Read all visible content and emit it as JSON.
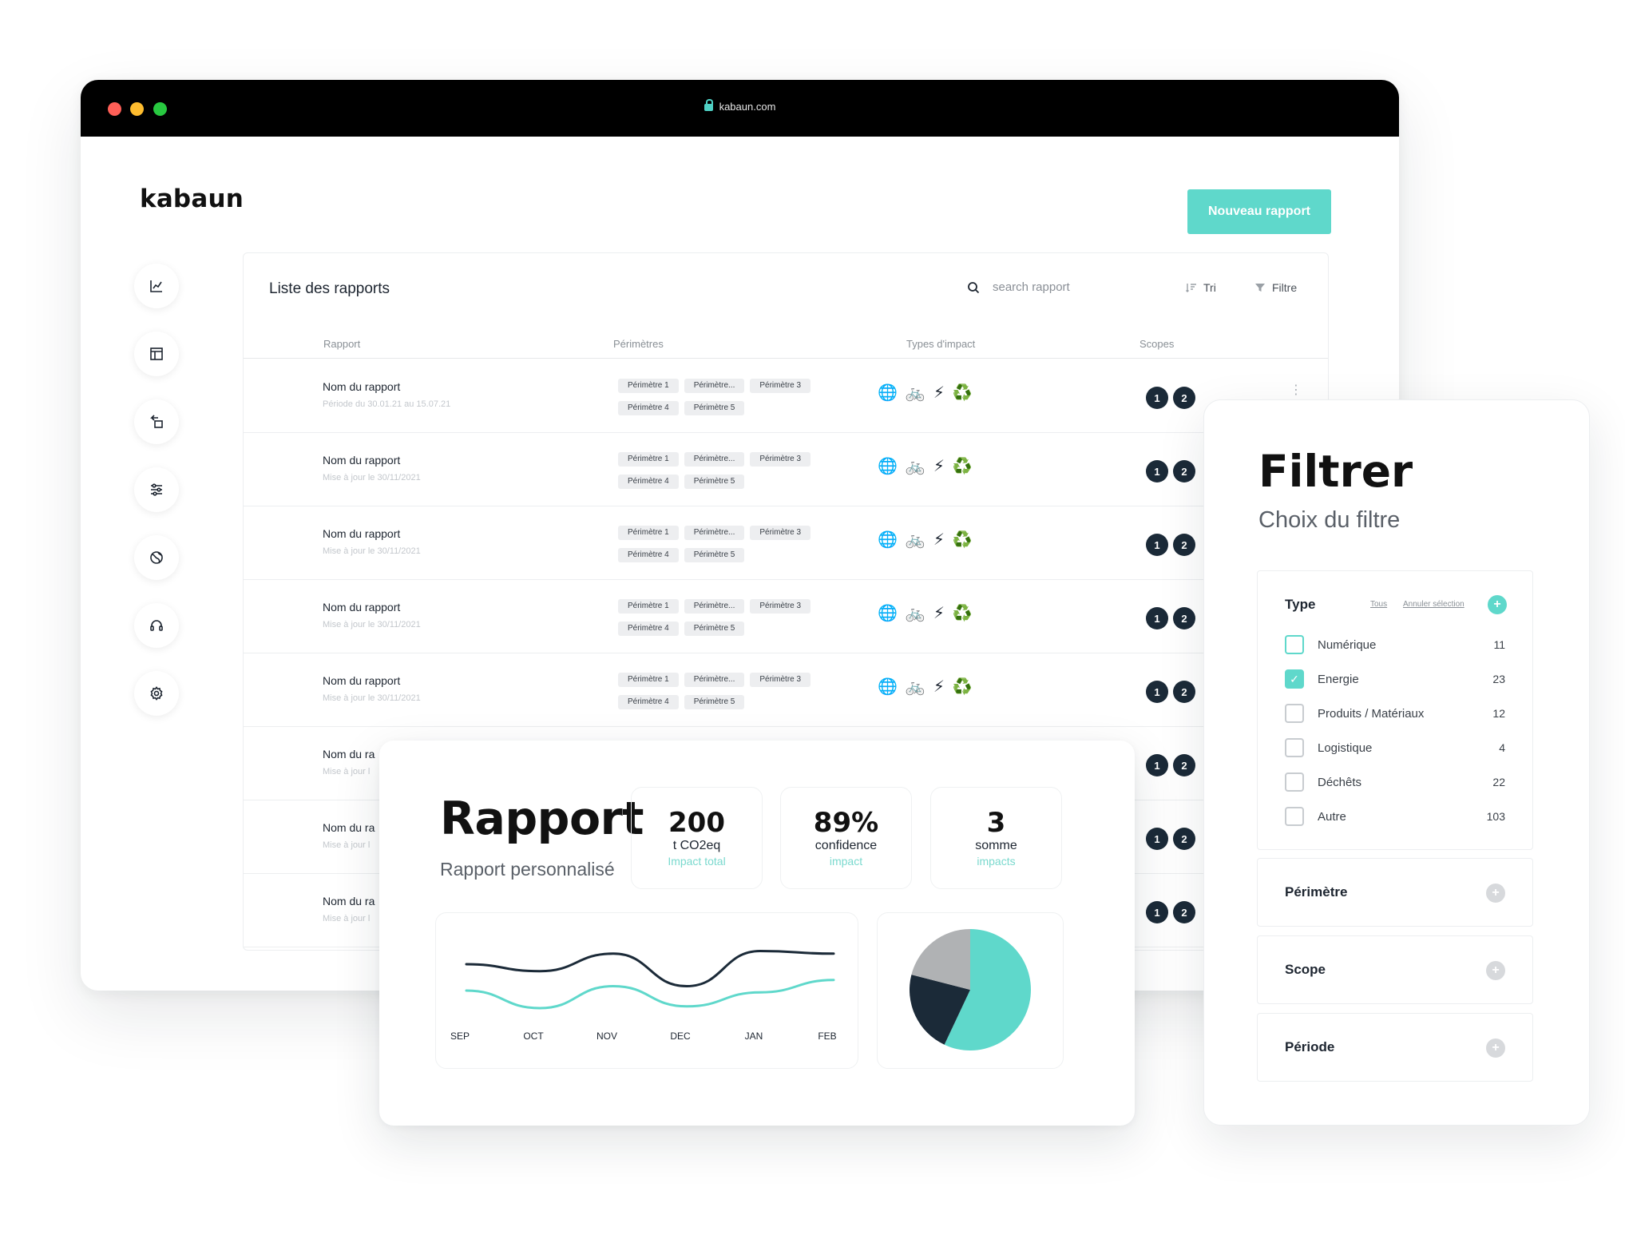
{
  "browser": {
    "url": "kabaun.com"
  },
  "app": {
    "logo": "kabaun",
    "new_report_button": "Nouveau rapport"
  },
  "sidebar": {
    "items": [
      {
        "name": "chart-icon"
      },
      {
        "name": "layout-icon"
      },
      {
        "name": "swap-icon"
      },
      {
        "name": "sliders-icon"
      },
      {
        "name": "globe-icon"
      },
      {
        "name": "headset-icon"
      },
      {
        "name": "gear-icon"
      }
    ]
  },
  "reports": {
    "title": "Liste des rapports",
    "search_placeholder": "search rapport",
    "sort_label": "Tri",
    "filter_label": "Filtre",
    "columns": [
      "Rapport",
      "Périmètres",
      "Types d'impact",
      "Scopes"
    ],
    "rows": [
      {
        "name": "Nom du rapport",
        "sub": "Période du 30.01.21 au 15.07.21",
        "perimeters": [
          "Périmètre 1",
          "Périmètre...",
          "Périmètre 3",
          "Périmètre 4",
          "Périmètre 5"
        ],
        "scopes": [
          "1",
          "2"
        ]
      },
      {
        "name": "Nom du rapport",
        "sub": "Mise à jour le 30/11/2021",
        "perimeters": [
          "Périmètre 1",
          "Périmètre...",
          "Périmètre 3",
          "Périmètre 4",
          "Périmètre 5"
        ],
        "scopes": [
          "1",
          "2"
        ]
      },
      {
        "name": "Nom du rapport",
        "sub": "Mise à jour le 30/11/2021",
        "perimeters": [
          "Périmètre 1",
          "Périmètre...",
          "Périmètre 3",
          "Périmètre 4",
          "Périmètre 5"
        ],
        "scopes": [
          "1",
          "2"
        ]
      },
      {
        "name": "Nom du rapport",
        "sub": "Mise à jour le 30/11/2021",
        "perimeters": [
          "Périmètre 1",
          "Périmètre...",
          "Périmètre 3",
          "Périmètre 4",
          "Périmètre 5"
        ],
        "scopes": [
          "1",
          "2"
        ]
      },
      {
        "name": "Nom du rapport",
        "sub": "Mise à jour le 30/11/2021",
        "perimeters": [
          "Périmètre 1",
          "Périmètre...",
          "Périmètre 3",
          "Périmètre 4",
          "Périmètre 5"
        ],
        "scopes": [
          "1",
          "2"
        ]
      },
      {
        "name": "Nom du ra",
        "sub": "Mise à jour l",
        "perimeters": [],
        "scopes": [
          "1",
          "2"
        ]
      },
      {
        "name": "Nom du ra",
        "sub": "Mise à jour l",
        "perimeters": [],
        "scopes": [
          "1",
          "2"
        ]
      },
      {
        "name": "Nom du ra",
        "sub": "Mise à jour l",
        "perimeters": [],
        "scopes": [
          "1",
          "2"
        ]
      }
    ],
    "impact_icons": [
      "🌐",
      "🚲",
      "⚡",
      "♻️"
    ]
  },
  "rapport_card": {
    "title": "Rapport",
    "subtitle": "Rapport personnalisé",
    "stats": [
      {
        "value": "200",
        "unit": "t CO2eq",
        "label": "Impact total"
      },
      {
        "value": "89%",
        "unit": "confidence",
        "label": "impact"
      },
      {
        "value": "3",
        "unit": "somme",
        "label": "impacts"
      }
    ]
  },
  "chart_data": [
    {
      "type": "line",
      "categories": [
        "SEP",
        "OCT",
        "NOV",
        "DEC",
        "JAN",
        "FEB"
      ],
      "series": [
        {
          "color": "#1b2a38",
          "values": [
            60,
            52,
            72,
            35,
            75,
            72
          ]
        },
        {
          "color": "#5fd8cb",
          "values": [
            30,
            10,
            35,
            12,
            28,
            42
          ]
        }
      ],
      "ylim": [
        0,
        100
      ]
    },
    {
      "type": "pie",
      "slices": [
        {
          "value": 57,
          "color": "#5fd8cb"
        },
        {
          "value": 22,
          "color": "#1b2a38"
        },
        {
          "value": 21,
          "color": "#b0b2b4"
        }
      ]
    }
  ],
  "filter": {
    "title": "Filtrer",
    "subtitle": "Choix du filtre",
    "type_section": {
      "title": "Type",
      "all_link": "Tous",
      "clear_link": "Annuler sélection",
      "options": [
        {
          "label": "Numérique",
          "count": "11",
          "checked": false
        },
        {
          "label": "Energie",
          "count": "23",
          "checked": true
        },
        {
          "label": "Produits / Matériaux",
          "count": "12",
          "checked": false
        },
        {
          "label": "Logistique",
          "count": "4",
          "checked": false
        },
        {
          "label": "Déchêts",
          "count": "22",
          "checked": false
        },
        {
          "label": "Autre",
          "count": "103",
          "checked": false
        }
      ]
    },
    "sections": [
      "Périmètre",
      "Scope",
      "Période"
    ]
  },
  "colors": {
    "accent": "#5fd8cb",
    "dark": "#1b2a38",
    "titlebar": "#000000"
  }
}
